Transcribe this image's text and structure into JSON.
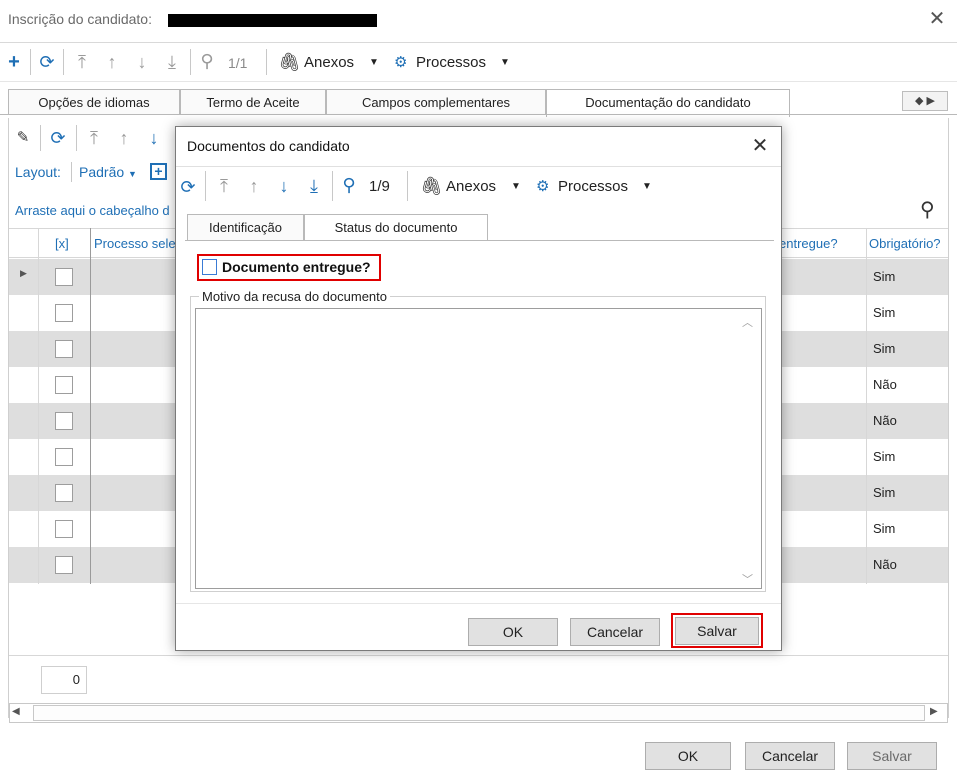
{
  "window": {
    "title": "Inscrição do candidato:",
    "close_glyph": "✕"
  },
  "main_toolbar": {
    "add_icon": "plus-icon",
    "refresh_icon": "refresh-icon",
    "counter": "1/1",
    "attachments_label": "Anexos",
    "processes_label": "Processos"
  },
  "main_tabs": [
    {
      "label": "Opções de idiomas"
    },
    {
      "label": "Termo de Aceite"
    },
    {
      "label": "Campos complementares"
    },
    {
      "label": "Documentação do candidato"
    }
  ],
  "grid": {
    "layout_label": "Layout:",
    "layout_value": "Padrão",
    "drag_hint": "Arraste aqui o cabeçalho d",
    "columns": {
      "select": "[x]",
      "process": "Processo sele",
      "delivered": "entregue?",
      "required": "Obrigatório?"
    },
    "rows": [
      {
        "required": "Sim"
      },
      {
        "required": "Sim"
      },
      {
        "required": "Sim"
      },
      {
        "required": "Não"
      },
      {
        "required": "Não"
      },
      {
        "required": "Sim"
      },
      {
        "required": "Sim"
      },
      {
        "required": "Sim"
      },
      {
        "required": "Não"
      }
    ],
    "footer_count": "0"
  },
  "bottom_buttons": {
    "ok": "OK",
    "cancel": "Cancelar",
    "save": "Salvar"
  },
  "modal": {
    "title": "Documentos do candidato",
    "counter": "1/9",
    "attachments_label": "Anexos",
    "processes_label": "Processos",
    "tabs": [
      {
        "label": "Identificação"
      },
      {
        "label": "Status do documento"
      }
    ],
    "document_delivered_label": "Documento entregue?",
    "refusal_reason_label": "Motivo da recusa do documento",
    "refusal_reason_value": "",
    "buttons": {
      "ok": "OK",
      "cancel": "Cancelar",
      "save": "Salvar"
    }
  },
  "colors": {
    "accent": "#1f6fb5",
    "highlight": "#e00000",
    "row_alt": "#dedede"
  }
}
